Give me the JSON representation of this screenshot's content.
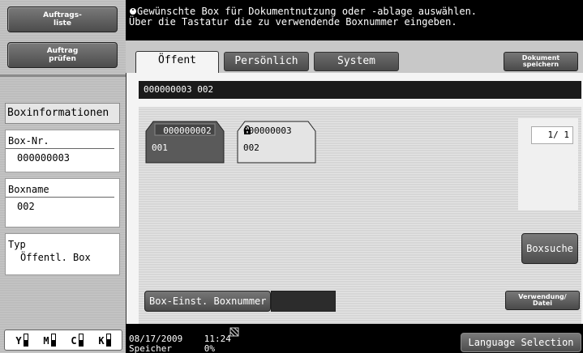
{
  "left_panel": {
    "jobs_button": [
      "Auftrags-",
      "liste"
    ],
    "check_button": [
      "Auftrag",
      "prüfen"
    ],
    "boxinfo_title": "Boxinformationen",
    "box_nr": {
      "label": "Box-Nr.",
      "value": "000000003"
    },
    "box_name": {
      "label": "Boxname",
      "value": "002"
    },
    "typ": {
      "label": "Typ",
      "value": "Öffentl. Box"
    },
    "toner": [
      {
        "letter": "Y",
        "level": 0.5
      },
      {
        "letter": "M",
        "level": 0.5
      },
      {
        "letter": "C",
        "level": 0.5
      },
      {
        "letter": "K",
        "level": 0.6
      }
    ]
  },
  "message": {
    "line1": "Gewünschte Box für Dokumentnutzung oder -ablage auswählen.",
    "line2": "Über die Tastatur die zu verwendende Boxnummer eingeben."
  },
  "tabs": {
    "oeffent": "Öffent",
    "persoenlich": "Persönlich",
    "system": "System",
    "save_document": [
      "Dokument",
      "speichern"
    ]
  },
  "path": "000000003  002",
  "boxes": [
    {
      "number": "000000002",
      "name": "001",
      "selected": true,
      "locked": false
    },
    {
      "number": "000000003",
      "name": "002",
      "selected": false,
      "locked": true
    }
  ],
  "pager": "1/  1",
  "box_search": "Boxsuche",
  "box_settings": "Box-Einst. Boxnummer",
  "boxnr_input": "",
  "usage_file": [
    "Verwendung/",
    "Datei"
  ],
  "status": {
    "date": "08/17/2009",
    "time": "11:24",
    "memory_label": "Speicher",
    "memory_value": "0%",
    "language_button": "Language Selection"
  },
  "colors": {
    "accent_dark": "#4a4a4a",
    "selected_box": "#555555"
  }
}
